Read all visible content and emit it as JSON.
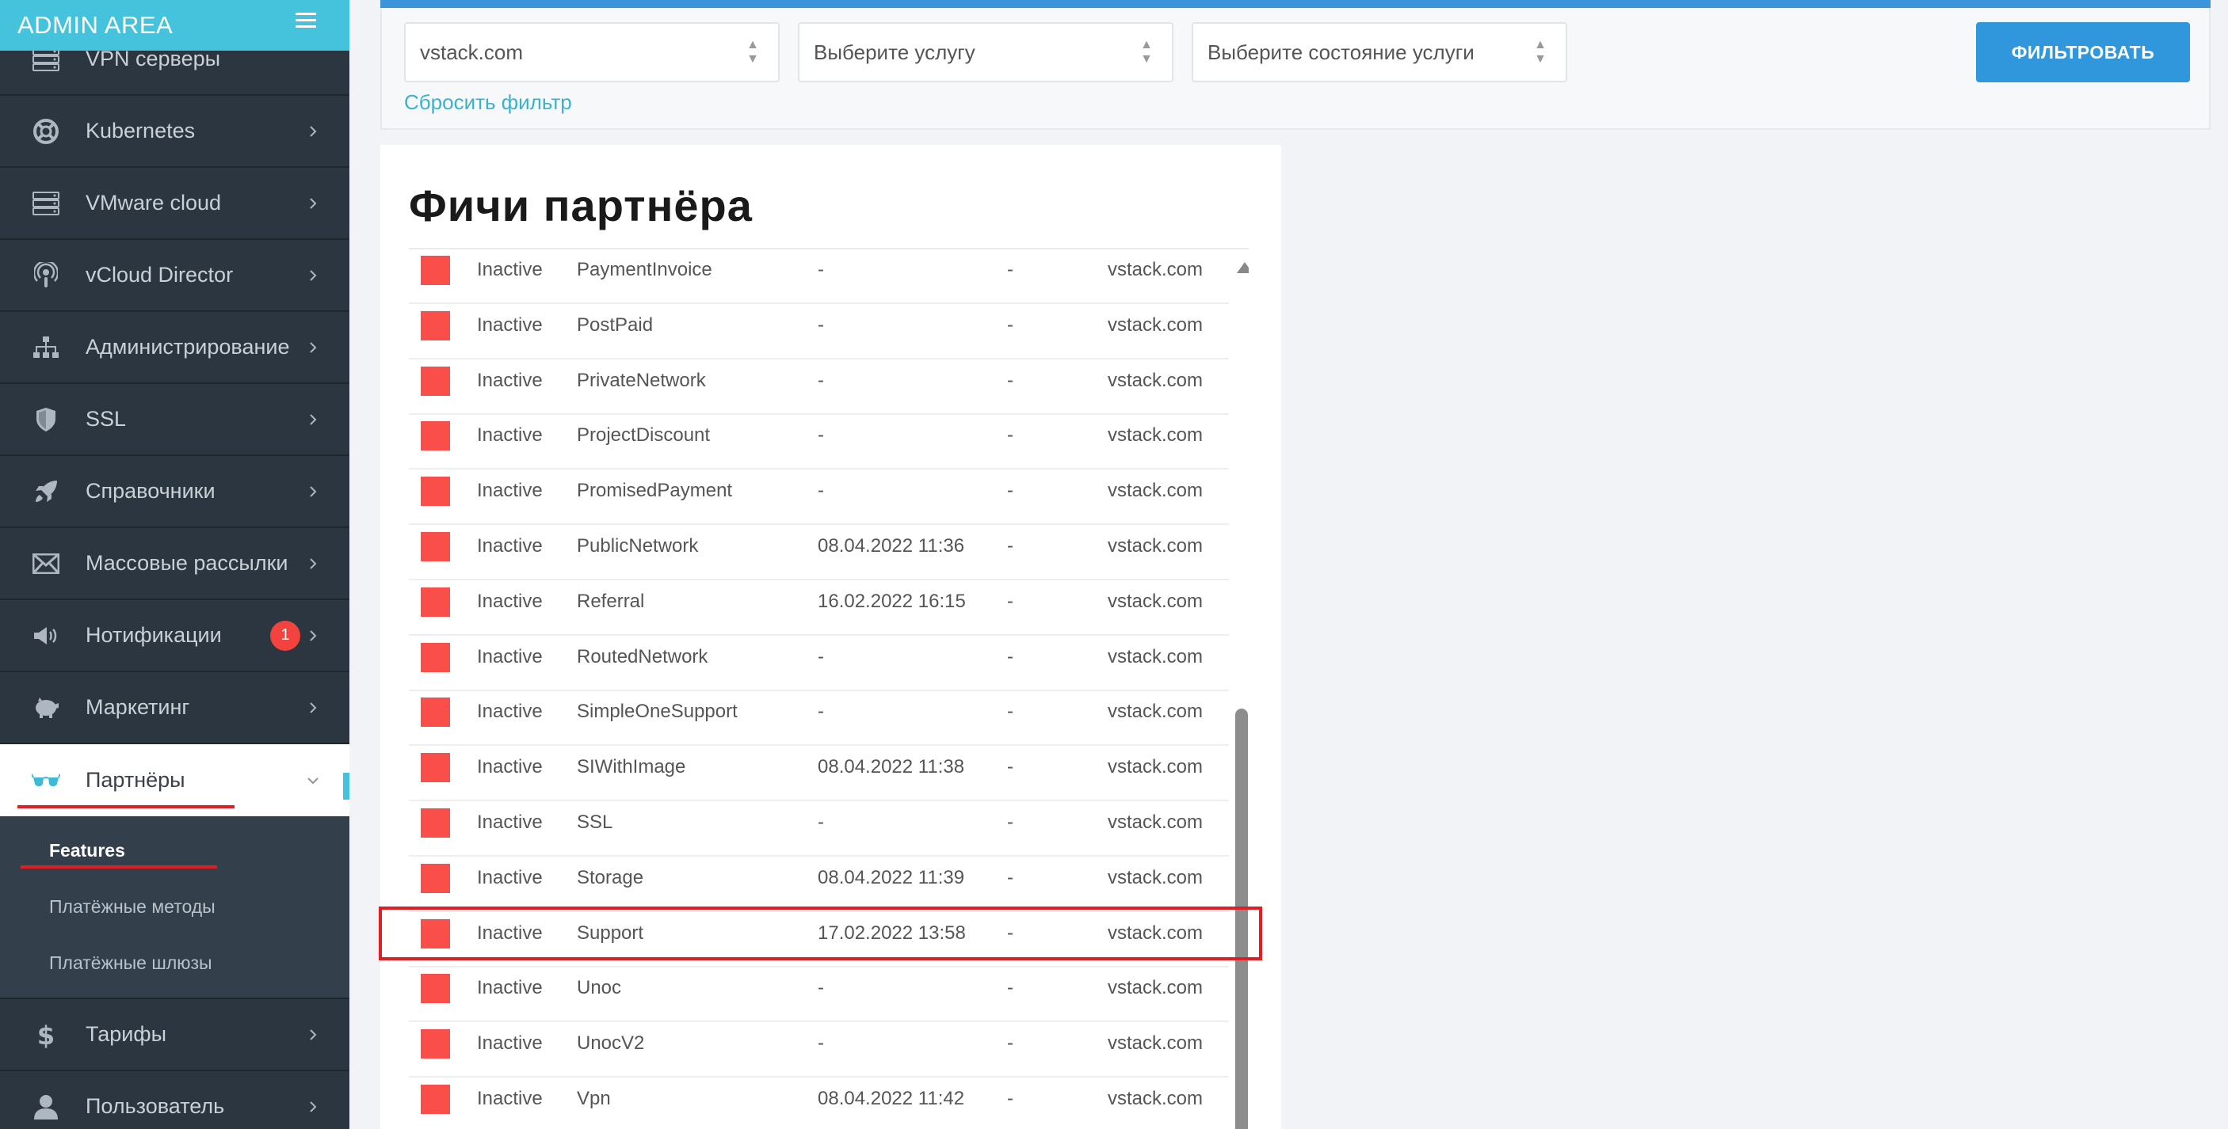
{
  "brand": {
    "title": "ADMIN AREA"
  },
  "sidebar": {
    "items": [
      {
        "label": "VPN серверы",
        "icon": "server-icon"
      },
      {
        "label": "Kubernetes",
        "icon": "lifebuoy-icon"
      },
      {
        "label": "VMware cloud",
        "icon": "server-icon"
      },
      {
        "label": "vCloud Director",
        "icon": "podcast-icon"
      },
      {
        "label": "Администрирование",
        "icon": "sitemap-icon"
      },
      {
        "label": "SSL",
        "icon": "shield-icon"
      },
      {
        "label": "Справочники",
        "icon": "rocket-icon"
      },
      {
        "label": "Массовые рассылки",
        "icon": "envelope-icon"
      },
      {
        "label": "Нотификации",
        "icon": "megaphone-icon",
        "badge": "1"
      },
      {
        "label": "Маркетинг",
        "icon": "piggy-bank-icon"
      },
      {
        "label": "Партнёры",
        "icon": "glasses-icon",
        "active": true
      },
      {
        "label": "Тарифы",
        "icon": "dollar-icon"
      },
      {
        "label": "Пользователь",
        "icon": "user-icon"
      }
    ],
    "submenu": [
      {
        "label": "Features",
        "current": true
      },
      {
        "label": "Платёжные методы"
      },
      {
        "label": "Платёжные шлюзы"
      }
    ]
  },
  "filter": {
    "partner_value": "vstack.com",
    "service_placeholder": "Выберите услугу",
    "state_placeholder": "Выберите состояние услуги",
    "reset_label": "Сбросить фильтр",
    "button_label": "ФИЛЬТРОВАТЬ"
  },
  "panel": {
    "title": "Фичи партнёра",
    "rows": [
      {
        "status": "Inactive",
        "name": "PaymentInvoice",
        "date": "-",
        "col4": "-",
        "domain": "vstack.com"
      },
      {
        "status": "Inactive",
        "name": "PostPaid",
        "date": "-",
        "col4": "-",
        "domain": "vstack.com"
      },
      {
        "status": "Inactive",
        "name": "PrivateNetwork",
        "date": "-",
        "col4": "-",
        "domain": "vstack.com"
      },
      {
        "status": "Inactive",
        "name": "ProjectDiscount",
        "date": "-",
        "col4": "-",
        "domain": "vstack.com"
      },
      {
        "status": "Inactive",
        "name": "PromisedPayment",
        "date": "-",
        "col4": "-",
        "domain": "vstack.com"
      },
      {
        "status": "Inactive",
        "name": "PublicNetwork",
        "date": "08.04.2022 11:36",
        "col4": "-",
        "domain": "vstack.com"
      },
      {
        "status": "Inactive",
        "name": "Referral",
        "date": "16.02.2022 16:15",
        "col4": "-",
        "domain": "vstack.com"
      },
      {
        "status": "Inactive",
        "name": "RoutedNetwork",
        "date": "-",
        "col4": "-",
        "domain": "vstack.com"
      },
      {
        "status": "Inactive",
        "name": "SimpleOneSupport",
        "date": "-",
        "col4": "-",
        "domain": "vstack.com"
      },
      {
        "status": "Inactive",
        "name": "SIWithImage",
        "date": "08.04.2022 11:38",
        "col4": "-",
        "domain": "vstack.com"
      },
      {
        "status": "Inactive",
        "name": "SSL",
        "date": "-",
        "col4": "-",
        "domain": "vstack.com"
      },
      {
        "status": "Inactive",
        "name": "Storage",
        "date": "08.04.2022 11:39",
        "col4": "-",
        "domain": "vstack.com"
      },
      {
        "status": "Inactive",
        "name": "Support",
        "date": "17.02.2022 13:58",
        "col4": "-",
        "domain": "vstack.com"
      },
      {
        "status": "Inactive",
        "name": "Unoc",
        "date": "-",
        "col4": "-",
        "domain": "vstack.com"
      },
      {
        "status": "Inactive",
        "name": "UnocV2",
        "date": "-",
        "col4": "-",
        "domain": "vstack.com"
      },
      {
        "status": "Inactive",
        "name": "Vpn",
        "date": "08.04.2022 11:42",
        "col4": "-",
        "domain": "vstack.com"
      }
    ]
  },
  "colors": {
    "brand": "#45c3dc",
    "sidebar_bg": "#2b3640",
    "status_inactive": "#fa4e4a",
    "primary_button": "#3097dc",
    "annotation": "#e31d24"
  }
}
